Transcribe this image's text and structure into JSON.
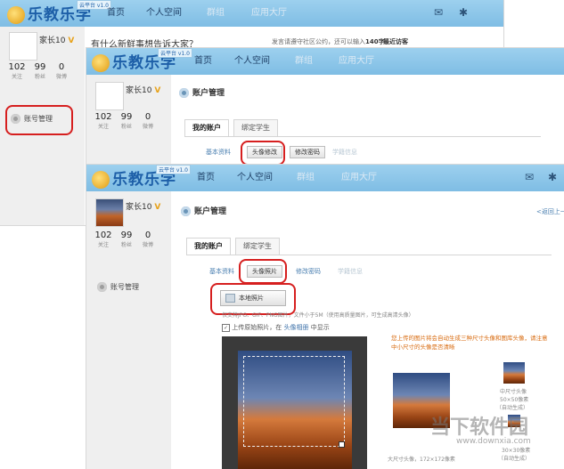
{
  "brand": {
    "logo_text": "乐教乐学",
    "version_badge": "云平台 v1.0"
  },
  "nav": {
    "home": "首页",
    "personal": "个人空间",
    "group": "群组",
    "apps": "应用大厅"
  },
  "user": {
    "name": "家长10",
    "vip_mark": "V",
    "stats": [
      {
        "value": "102",
        "label": "关注"
      },
      {
        "value": "99",
        "label": "粉丝"
      },
      {
        "value": "0",
        "label": "微博"
      }
    ]
  },
  "sidebar": {
    "account_mgmt": "账号管理"
  },
  "layer1": {
    "prompt": "有什么新鲜事想告诉大家？",
    "notice": "发言请遵守社区公约，还可以输入",
    "count": "140字",
    "recent": "最近访客"
  },
  "page": {
    "title": "账户管理",
    "back_link": "<返回上一",
    "tabs": {
      "my_account": "我的账户",
      "bind_student": "绑定学生"
    },
    "subtabs": {
      "basic": "基本资料",
      "avatar": "头像照片",
      "password": "修改密码",
      "info": "学籍信息"
    }
  },
  "layer2": {
    "avatar_subtab": "头像修改"
  },
  "upload": {
    "button": "本地照片",
    "hint": "仅支持JPG、GIF、PNG图片，文件小于5M（使用高质量图片，可生成高清头像）",
    "checkbox": "上传原始照片，在",
    "album_link": "头像相册",
    "checkbox_tail": "中显示"
  },
  "preview": {
    "desc": "您上传的图片将会自动生成三种尺寸头像和图库头像，请注意中小尺寸的头像是否清晰",
    "large_caption": "大尺寸头像，172×172像素",
    "medium_caption": "中尺寸头像",
    "medium_size": "50×50像素",
    "small_size": "30×30像素",
    "auto_generated": "（自动生成）"
  },
  "watermark": {
    "text": "当下软件园",
    "url": "www.downxia.com"
  }
}
